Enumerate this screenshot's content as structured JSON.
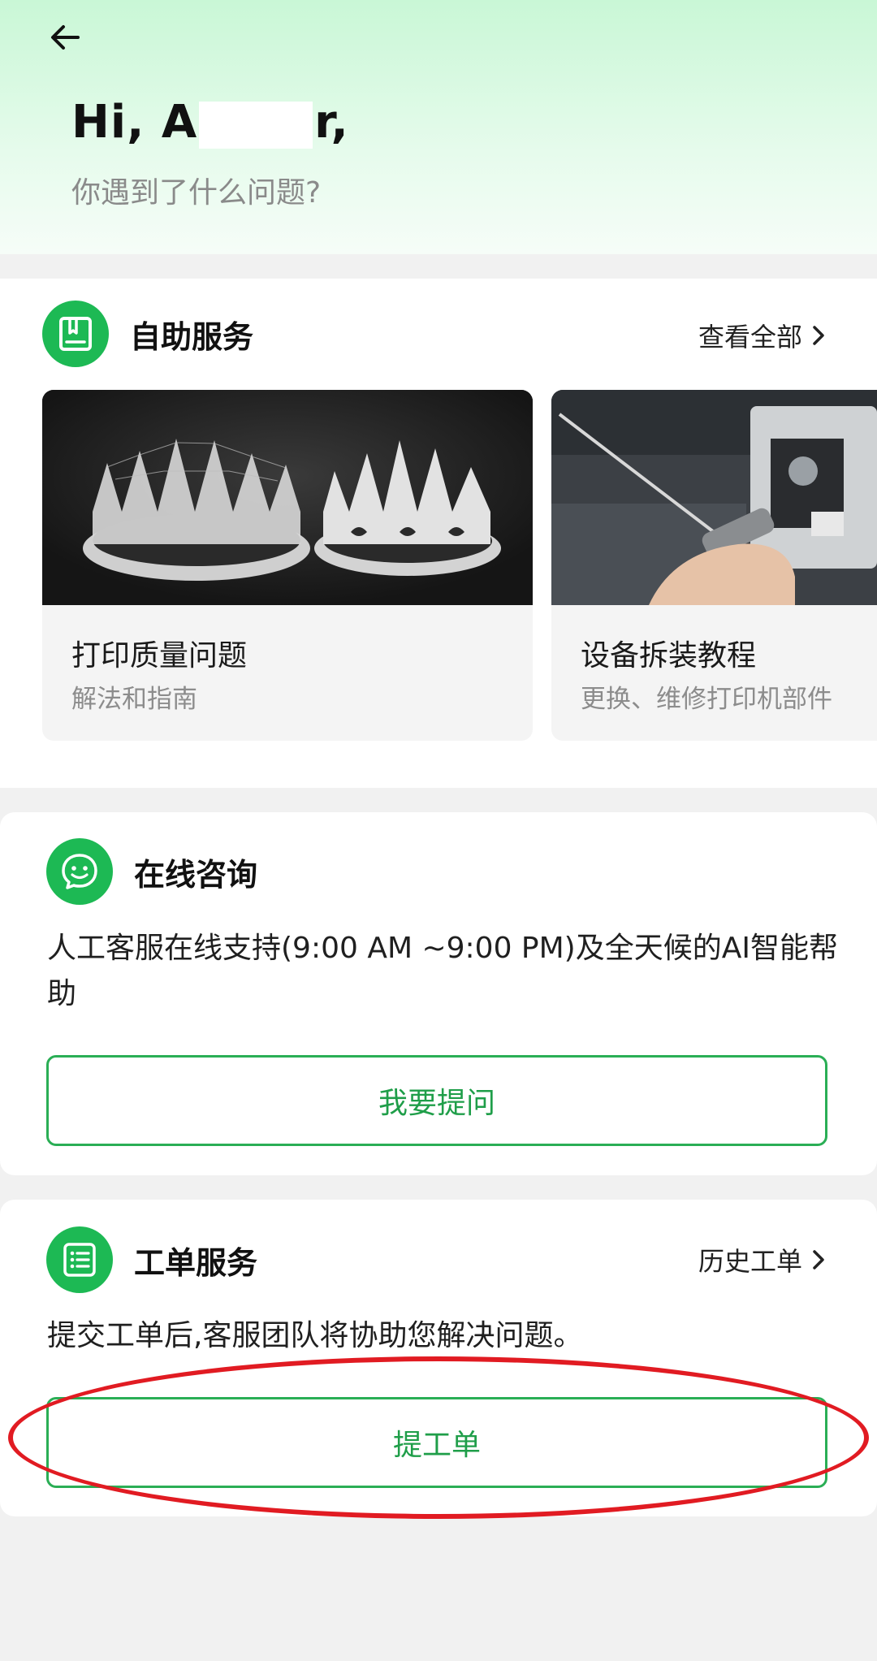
{
  "header": {
    "greeting_prefix": "Hi, A",
    "greeting_suffix": "r,",
    "subtitle": "你遇到了什么问题?"
  },
  "self_service": {
    "title": "自助服务",
    "view_all": "查看全部",
    "tiles": [
      {
        "title": "打印质量问题",
        "subtitle": "解法和指南"
      },
      {
        "title": "设备拆装教程",
        "subtitle": "更换、维修打印机部件"
      }
    ]
  },
  "online_consult": {
    "title": "在线咨询",
    "description": "人工客服在线支持(9:00 AM ~9:00 PM)及全天候的AI智能帮助",
    "button": "我要提问"
  },
  "ticket_service": {
    "title": "工单服务",
    "history": "历史工单",
    "description": "提交工单后,客服团队将协助您解决问题。",
    "button": "提工单"
  },
  "colors": {
    "brand_green": "#1db954",
    "button_text_green": "#1f9e49",
    "annotation_red": "#e11b22"
  },
  "icons": [
    "back-arrow-icon",
    "book-icon",
    "smile-chat-icon",
    "list-icon",
    "chevron-right-icon"
  ]
}
